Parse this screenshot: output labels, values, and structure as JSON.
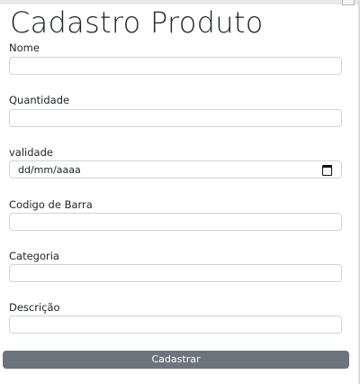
{
  "form": {
    "title": "Cadastro Produto",
    "fields": {
      "nome": {
        "label": "Nome",
        "value": "",
        "placeholder": ""
      },
      "quantidade": {
        "label": "Quantidade",
        "value": "",
        "placeholder": ""
      },
      "validade": {
        "label": "validade",
        "placeholder": "dd/mm/aaaa",
        "icon": "calendar-icon"
      },
      "codigo_barra": {
        "label": "Codigo de Barra",
        "value": "",
        "placeholder": ""
      },
      "categoria": {
        "label": "Categoria",
        "value": "",
        "placeholder": ""
      },
      "descricao": {
        "label": "Descrição",
        "value": "",
        "placeholder": ""
      }
    },
    "submit_label": "Cadastrar"
  },
  "colors": {
    "button_background": "#6c757d",
    "button_text": "#ffffff",
    "input_border": "#ced4da",
    "text": "#212529"
  }
}
